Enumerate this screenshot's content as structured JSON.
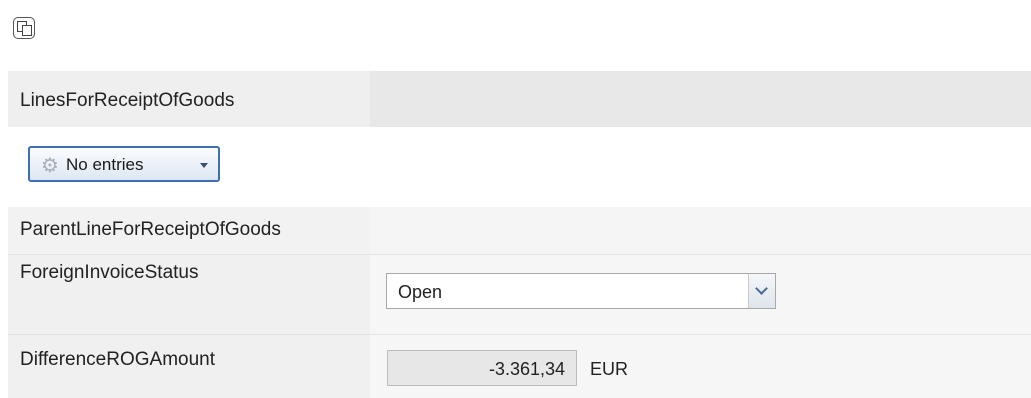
{
  "toolbar": {
    "copy_icon": "copy-icon"
  },
  "fields": {
    "lines_for_receipt_of_goods": {
      "label": "LinesForReceiptOfGoods",
      "button_label": "No entries",
      "button_icon": "gear-icon"
    },
    "parent_line_for_receipt_of_goods": {
      "label": "ParentLineForReceiptOfGoods"
    },
    "foreign_invoice_status": {
      "label": "ForeignInvoiceStatus",
      "selected_value": "Open"
    },
    "difference_rog_amount": {
      "label": "DifferenceROGAmount",
      "value": "-3.361,34",
      "currency": "EUR"
    }
  },
  "colors": {
    "button_border": "#3f6fb3",
    "row_background": "#f0f0f0"
  }
}
